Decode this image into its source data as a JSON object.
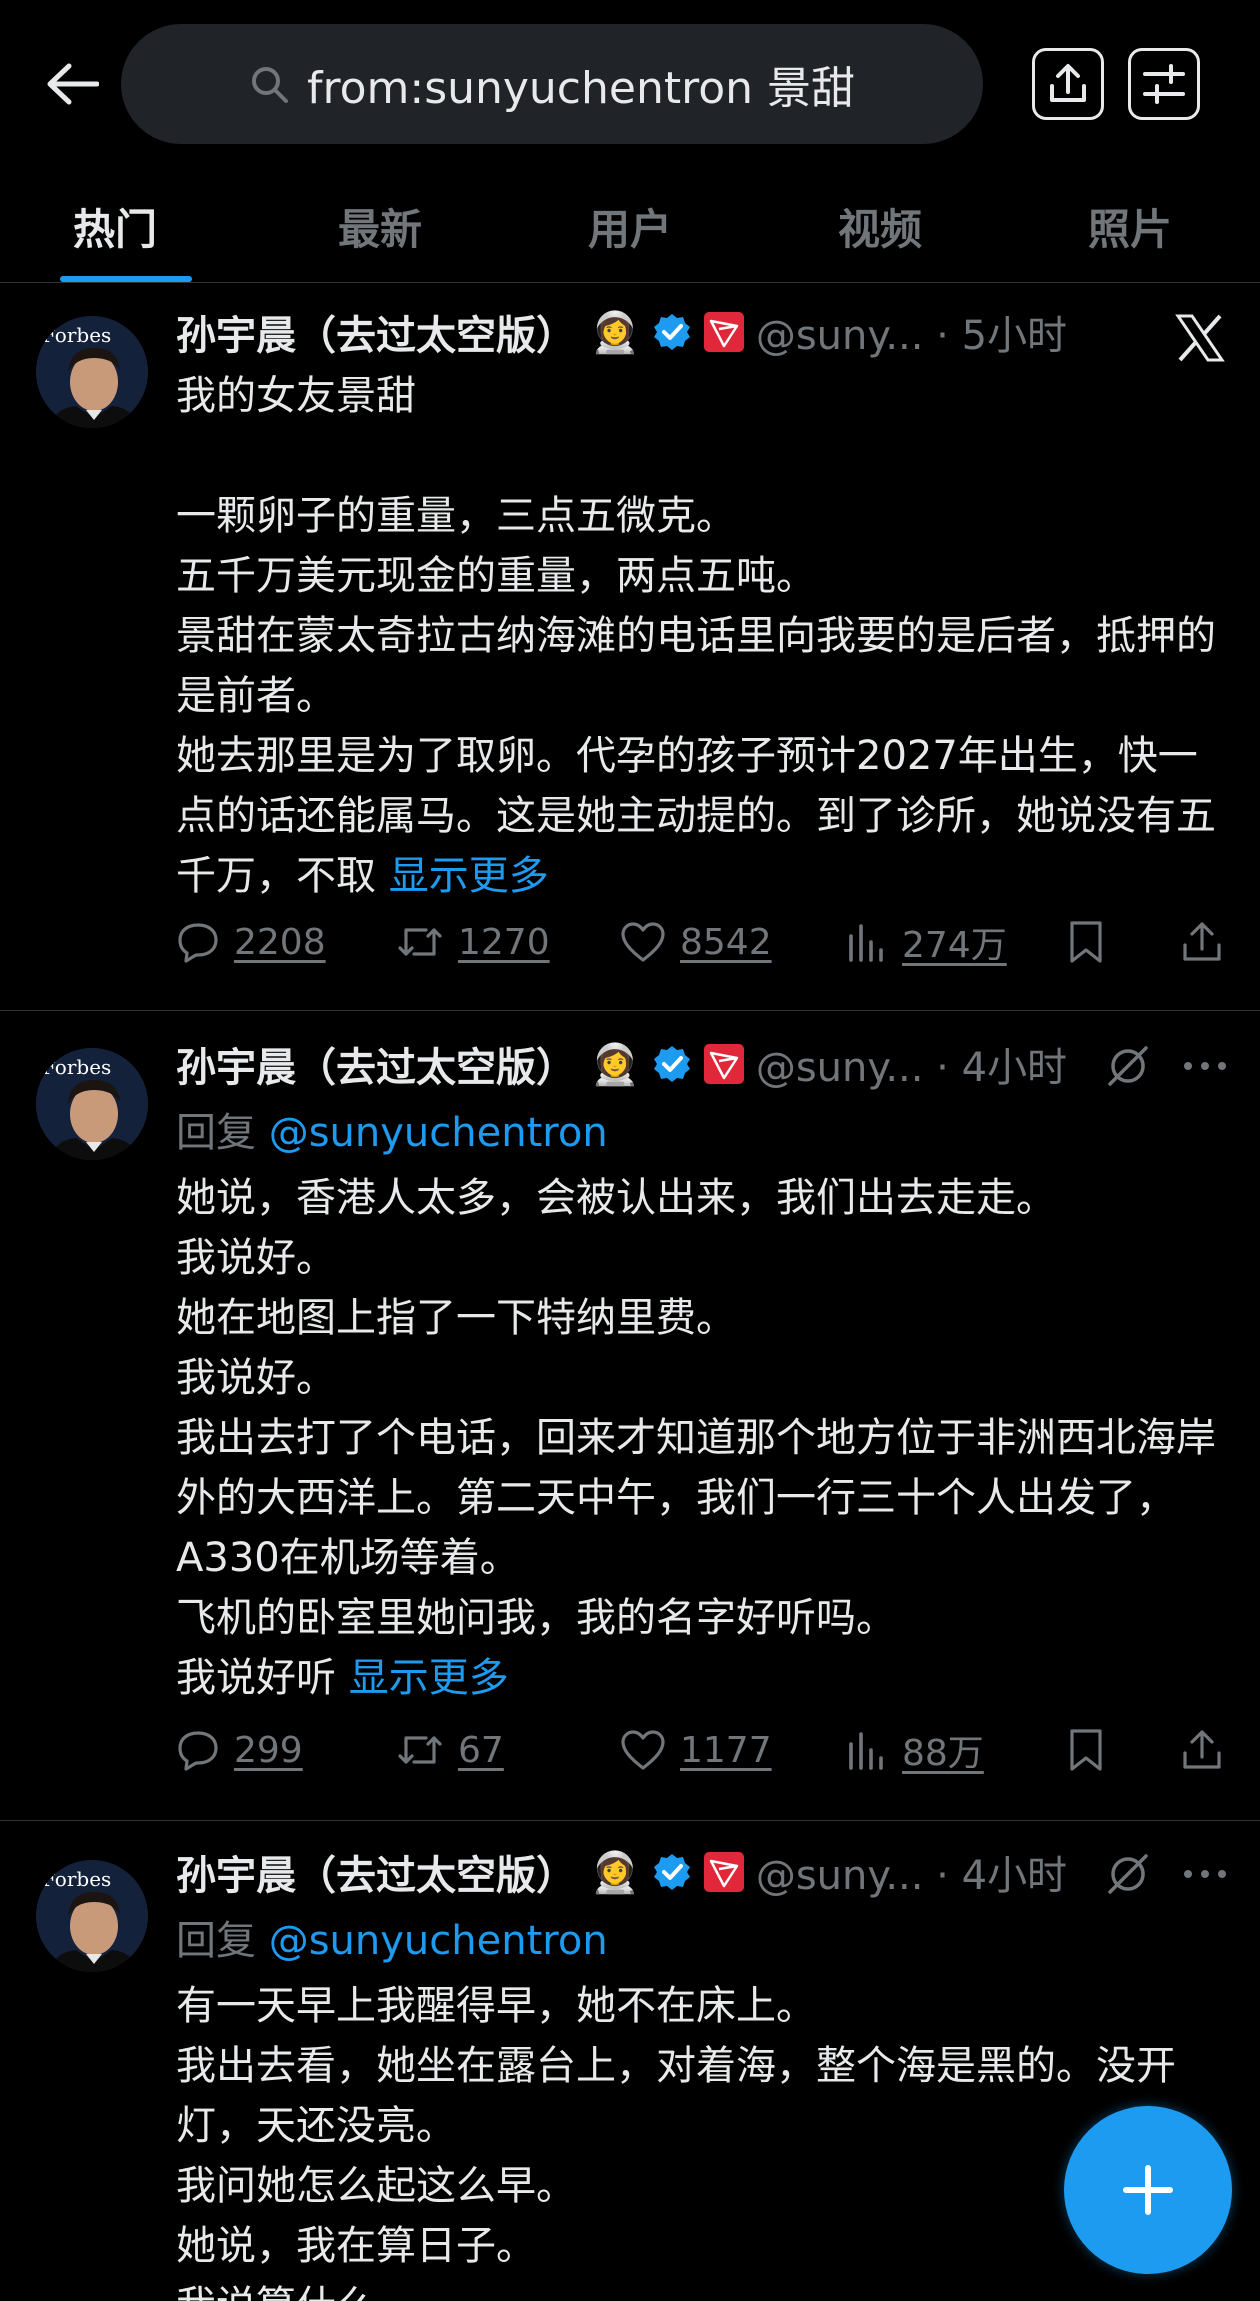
{
  "search": {
    "query": "from:sunyuchentron 景甜"
  },
  "tabs": [
    {
      "label": "热门"
    },
    {
      "label": "最新"
    },
    {
      "label": "用户"
    },
    {
      "label": "视频"
    },
    {
      "label": "照片"
    }
  ],
  "tweets": [
    {
      "author": "孙宇晨（去过太空版）",
      "emoji": "👩‍🚀",
      "handle": "@suny... · 5小时",
      "avatar_text": "Forbes",
      "lines": [
        "我的女友景甜",
        "",
        "一颗卵子的重量，三点五微克。",
        "五千万美元现金的重量，两点五吨。",
        "景甜在蒙太奇拉古纳海滩的电话里向我要的是后者，抵押的是前者。",
        "她去那里是为了取卵。代孕的孩子预计2027年出生，快一点的话还能属马。这是她主动提的。到了诊所，她说没有五千万，不取"
      ],
      "show_more": "显示更多",
      "stats": {
        "replies": "2208",
        "retweets": "1270",
        "likes": "8542",
        "views": "274万"
      }
    },
    {
      "author": "孙宇晨（去过太空版）",
      "emoji": "👩‍🚀",
      "handle": "@suny... · 4小时",
      "avatar_text": "Forbes",
      "reply_prefix": "回复",
      "reply_to": "@sunyuchentron",
      "lines": [
        "她说，香港人太多，会被认出来，我们出去走走。",
        "我说好。",
        "她在地图上指了一下特纳里费。",
        "我说好。",
        "我出去打了个电话，回来才知道那个地方位于非洲西北海岸外的大西洋上。第二天中午，我们一行三十个人出发了，A330在机场等着。",
        "飞机的卧室里她问我，我的名字好听吗。",
        "我说好听"
      ],
      "show_more": "显示更多",
      "stats": {
        "replies": "299",
        "retweets": "67",
        "likes": "1177",
        "views": "88万"
      }
    },
    {
      "author": "孙宇晨（去过太空版）",
      "emoji": "👩‍🚀",
      "handle": "@suny... · 4小时",
      "avatar_text": "Forbes",
      "reply_prefix": "回复",
      "reply_to": "@sunyuchentron",
      "lines": [
        "有一天早上我醒得早，她不在床上。",
        "我出去看，她坐在露台上，对着海，整个海是黑的。没开灯，天还没亮。",
        "我问她怎么起这么早。",
        "她说，我在算日子。",
        "我说算什么"
      ]
    }
  ],
  "colors": {
    "accent": "#1d9bf0",
    "background": "#000000",
    "muted": "#71767b",
    "text": "#e7e9ea",
    "tron_red": "#e0283a"
  }
}
